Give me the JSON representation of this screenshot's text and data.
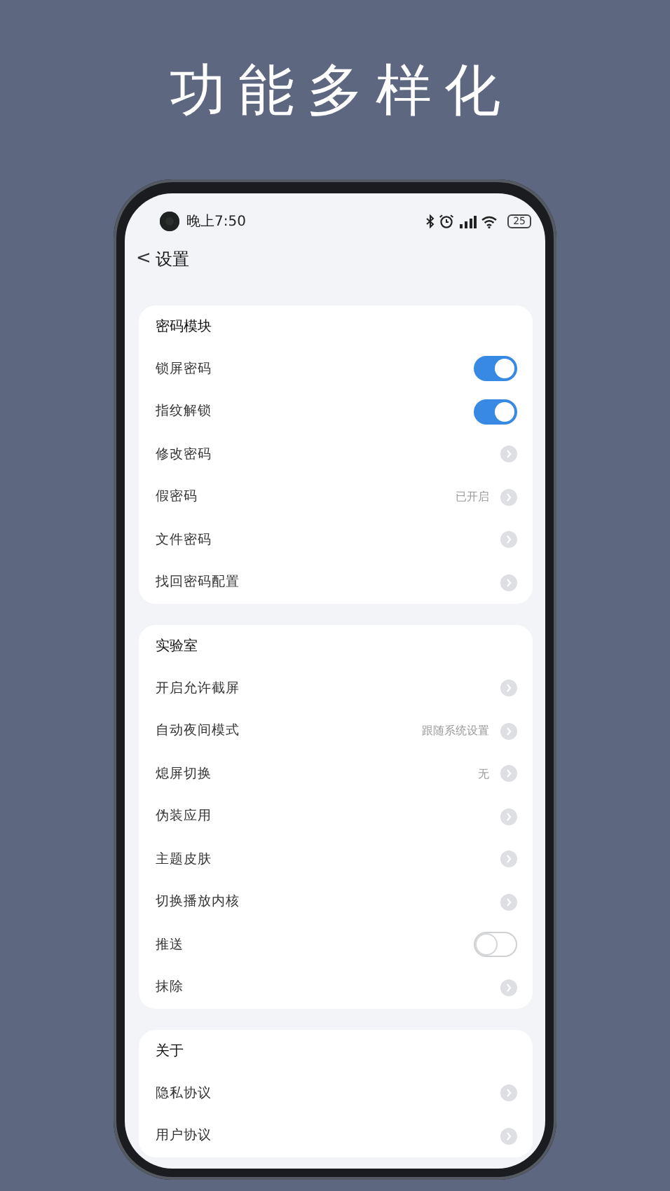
{
  "headline": "功能多样化",
  "status_bar": {
    "time": "晚上7:50",
    "battery": "25"
  },
  "header": {
    "back": "<",
    "title": "设置"
  },
  "sections": [
    {
      "title": "密码模块",
      "items": [
        {
          "kind": "toggle",
          "label": "锁屏密码",
          "on": true
        },
        {
          "kind": "toggle",
          "label": "指纹解锁",
          "on": true
        },
        {
          "kind": "link",
          "label": "修改密码"
        },
        {
          "kind": "link",
          "label": "假密码",
          "value": "已开启"
        },
        {
          "kind": "link",
          "label": "文件密码"
        },
        {
          "kind": "link",
          "label": "找回密码配置"
        }
      ]
    },
    {
      "title": "实验室",
      "items": [
        {
          "kind": "link",
          "label": "开启允许截屏"
        },
        {
          "kind": "link",
          "label": "自动夜间模式",
          "value": "跟随系统设置"
        },
        {
          "kind": "link",
          "label": "熄屏切换",
          "value": "无"
        },
        {
          "kind": "link",
          "label": "伪装应用"
        },
        {
          "kind": "link",
          "label": "主题皮肤"
        },
        {
          "kind": "link",
          "label": "切换播放内核"
        },
        {
          "kind": "toggle",
          "label": "推送",
          "on": false
        },
        {
          "kind": "link",
          "label": "抹除"
        }
      ]
    },
    {
      "title": "关于",
      "items": [
        {
          "kind": "link",
          "label": "隐私协议"
        },
        {
          "kind": "link",
          "label": "用户协议"
        }
      ]
    }
  ]
}
